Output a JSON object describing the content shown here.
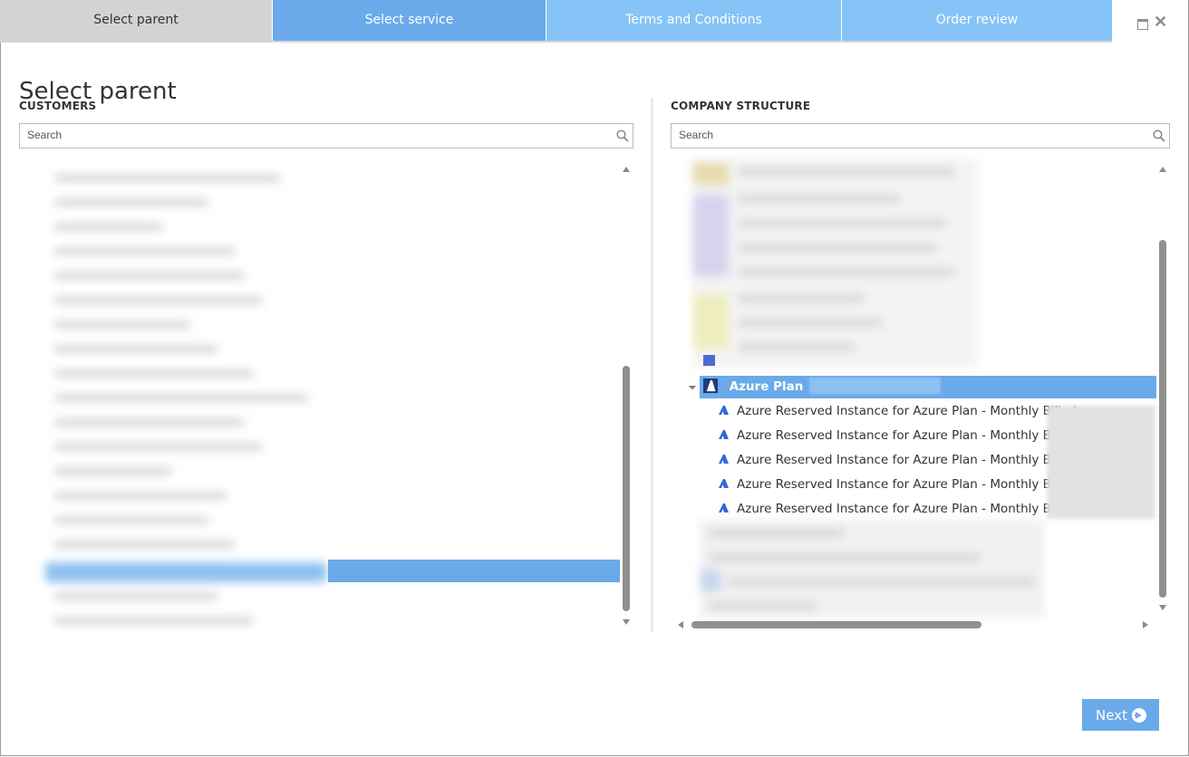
{
  "wizard": {
    "tabs": [
      {
        "label": "Select parent",
        "state": "active"
      },
      {
        "label": "Select service",
        "state": "next"
      },
      {
        "label": "Terms and Conditions",
        "state": "upcoming"
      },
      {
        "label": "Order review",
        "state": "upcoming"
      }
    ]
  },
  "window_controls": {
    "restore_icon": "restore-icon",
    "close_icon": "close-icon"
  },
  "page": {
    "title": "Select parent"
  },
  "customers": {
    "label": "CUSTOMERS",
    "search_placeholder": "Search"
  },
  "company_structure": {
    "label": "COMPANY STRUCTURE",
    "search_placeholder": "Search",
    "plan_row": {
      "label": "Azure Plan",
      "icon": "azure-icon"
    },
    "children": [
      {
        "label": "Azure Reserved Instance for Azure Plan - Monthly Billed",
        "icon": "azure-icon"
      },
      {
        "label": "Azure Reserved Instance for Azure Plan - Monthly Billed",
        "icon": "azure-icon"
      },
      {
        "label": "Azure Reserved Instance for Azure Plan - Monthly Billed",
        "icon": "azure-icon"
      },
      {
        "label": "Azure Reserved Instance for Azure Plan - Monthly Billed",
        "icon": "azure-icon"
      },
      {
        "label": "Azure Reserved Instance for Azure Plan - Monthly Billed",
        "icon": "azure-icon"
      }
    ]
  },
  "footer": {
    "next_label": "Next"
  },
  "colors": {
    "accent": "#6aaaea",
    "accent_light": "#86c3f6",
    "tab_inactive": "#d3d3d3"
  }
}
